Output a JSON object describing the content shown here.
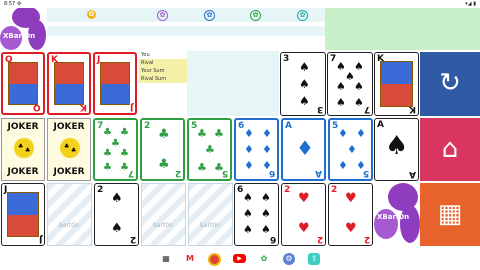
{
  "status": {
    "time": "8:57",
    "right": "▾◢ ▮"
  },
  "logo": {
    "text": "XBart0n"
  },
  "scoreboard": {
    "labels": [
      "You",
      "Rival",
      "Your Sum",
      "Rival Sum"
    ]
  },
  "cards": {
    "top_left": [
      {
        "rank": "Q",
        "suit": "♥",
        "color": "red"
      },
      {
        "rank": "K",
        "suit": "♥",
        "color": "red"
      },
      {
        "rank": "J",
        "suit": "♥",
        "color": "red"
      }
    ],
    "top_right": [
      {
        "rank": "3",
        "suit": "♠",
        "color": "black"
      },
      {
        "rank": "7",
        "suit": "♠",
        "color": "black"
      },
      {
        "rank": "K",
        "suit": "♠",
        "color": "black"
      }
    ],
    "middle": [
      {
        "rank": "JOKER",
        "type": "joker"
      },
      {
        "rank": "JOKER",
        "type": "joker"
      },
      {
        "rank": "7",
        "suit": "♣",
        "color": "black",
        "border": "green"
      },
      {
        "rank": "2",
        "suit": "♣",
        "color": "black",
        "border": "green"
      },
      {
        "rank": "5",
        "suit": "♣",
        "color": "black",
        "border": "green"
      },
      {
        "rank": "6",
        "suit": "♦",
        "color": "blue",
        "border": "blue"
      },
      {
        "rank": "A",
        "suit": "♦",
        "color": "blue",
        "border": "blue"
      },
      {
        "rank": "5",
        "suit": "♦",
        "color": "blue",
        "border": "blue"
      },
      {
        "rank": "A",
        "suit": "♠",
        "color": "black"
      }
    ],
    "bottom": [
      {
        "rank": "J",
        "suit": "♠",
        "color": "black",
        "type": "face"
      },
      {
        "type": "back",
        "text": "bart0n"
      },
      {
        "rank": "2",
        "suit": "♠",
        "color": "black"
      },
      {
        "type": "back",
        "text": "bart0n"
      },
      {
        "type": "back",
        "text": "bart0n"
      },
      {
        "rank": "6",
        "suit": "♠",
        "color": "black"
      },
      {
        "rank": "2",
        "suit": "♥",
        "color": "red"
      },
      {
        "rank": "2",
        "suit": "♥",
        "color": "red"
      }
    ]
  },
  "side_buttons": [
    {
      "name": "restart",
      "icon": "↻",
      "color": "#2f5aa6"
    },
    {
      "name": "home",
      "icon": "⌂",
      "color": "#d8365f"
    },
    {
      "name": "calculator",
      "icon": "▦",
      "color": "#e8632b"
    }
  ],
  "nav_icons": [
    "▦",
    "M",
    "●",
    "▶",
    "✿",
    "⚙",
    "⇪"
  ]
}
